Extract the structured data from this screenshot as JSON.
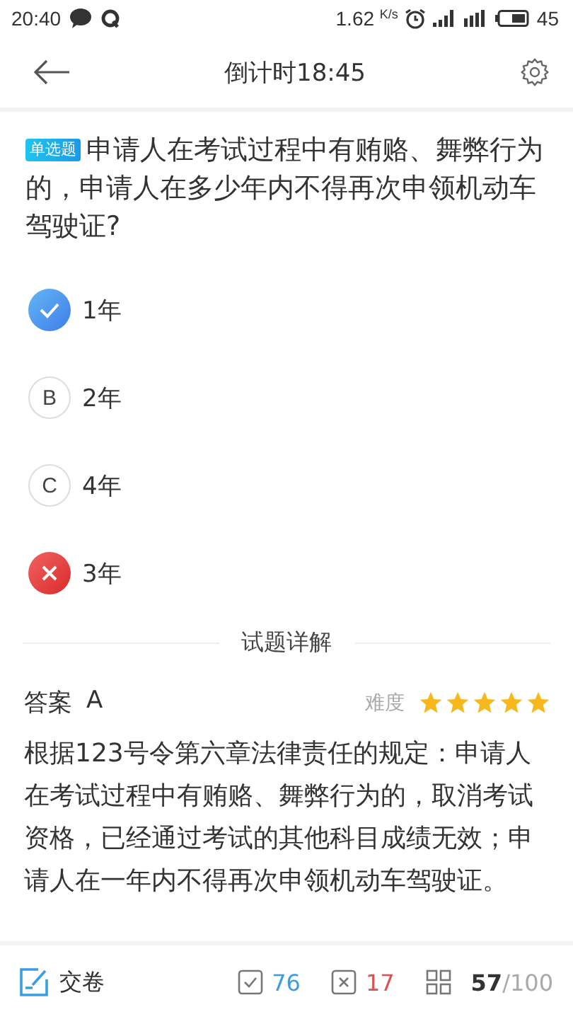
{
  "status_bar": {
    "time": "20:40",
    "speed": "1.62",
    "speed_unit": "K/s",
    "battery": "45"
  },
  "header": {
    "title": "倒计时18:45"
  },
  "question": {
    "type_badge": "单选题",
    "text": "申请人在考试过程中有贿赂、舞弊行为的，申请人在多少年内不得再次申领机动车驾驶证?"
  },
  "options": [
    {
      "kind": "correct",
      "text": "1年"
    },
    {
      "kind": "letter",
      "letter": "B",
      "text": "2年"
    },
    {
      "kind": "letter",
      "letter": "C",
      "text": "4年"
    },
    {
      "kind": "wrong",
      "text": "3年"
    }
  ],
  "explanation": {
    "heading": "试题详解",
    "answer_label": "答案",
    "answer": "A",
    "difficulty_label": "难度",
    "stars": 5,
    "text": "根据123号令第六章法律责任的规定：申请人在考试过程中有贿赂、舞弊行为的，取消考试资格，已经通过考试的其他科目成绩无效；申请人在一年内不得再次申领机动车驾驶证。"
  },
  "bottom_bar": {
    "submit": "交卷",
    "correct_count": "76",
    "wrong_count": "17",
    "current": "57",
    "total": "/100"
  }
}
